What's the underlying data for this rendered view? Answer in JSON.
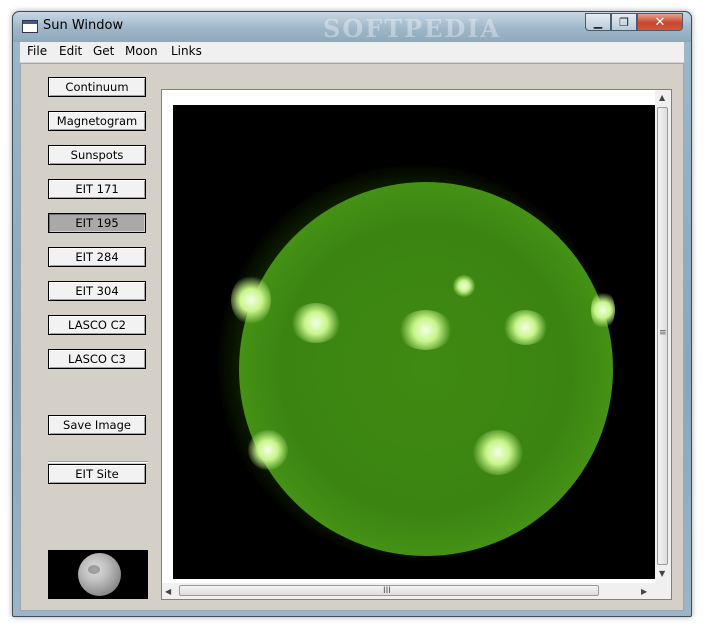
{
  "window": {
    "title": "Sun Window",
    "watermark": "SOFTPEDIA"
  },
  "title_buttons": {
    "minimize": "▁",
    "maximize": "❐",
    "close": "✕"
  },
  "menu": [
    "File",
    "Edit",
    "Get",
    "Moon",
    "Links"
  ],
  "image_buttons": [
    {
      "label": "Continuum",
      "pressed": false
    },
    {
      "label": "Magnetogram",
      "pressed": false
    },
    {
      "label": "Sunspots",
      "pressed": false
    },
    {
      "label": "EIT 171",
      "pressed": false
    },
    {
      "label": "EIT 195",
      "pressed": true
    },
    {
      "label": "EIT 284",
      "pressed": false
    },
    {
      "label": "EIT 304",
      "pressed": false
    },
    {
      "label": "LASCO C2",
      "pressed": false
    },
    {
      "label": "LASCO C3",
      "pressed": false
    }
  ],
  "actions": {
    "save_image": "Save Image",
    "eit_site": "EIT Site"
  },
  "scrollbars": {
    "up": "▲",
    "down": "▼",
    "left": "◀",
    "right": "▶",
    "v_grip": "≡",
    "h_grip": "III"
  },
  "colors": {
    "sun_green": "#4a9a18",
    "flare": "#f3ffe6",
    "pressed_button": "#a9a9a9"
  },
  "moon_thumbnail": {
    "phase_icon": "moon-icon"
  }
}
